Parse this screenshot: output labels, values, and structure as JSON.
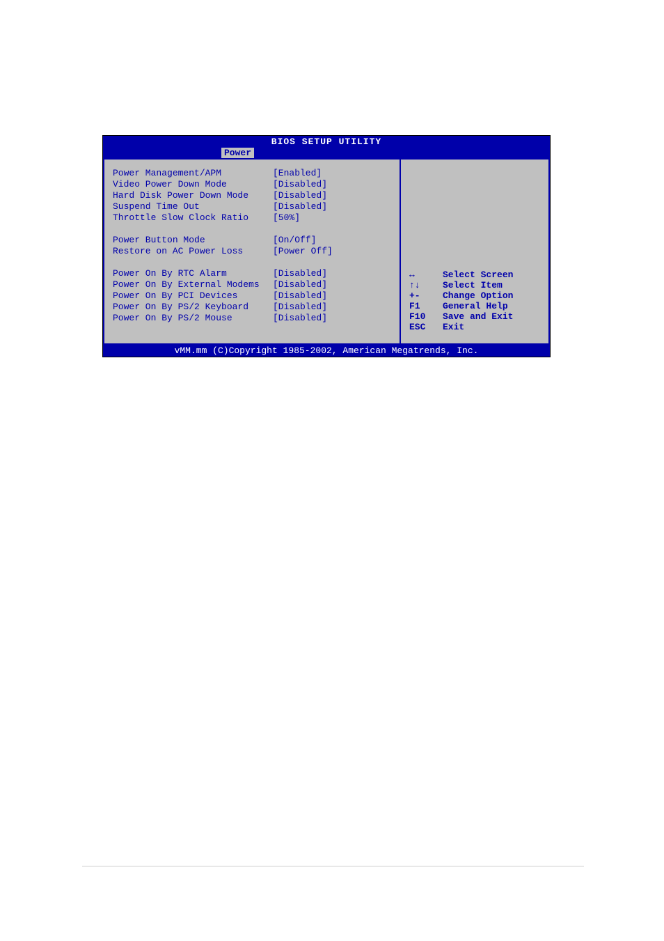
{
  "title": "BIOS SETUP UTILITY",
  "active_tab": "Power",
  "settings_group1": [
    {
      "label": "Power Management/APM",
      "value": "[Enabled]"
    },
    {
      "label": "Video Power Down Mode",
      "value": "[Disabled]"
    },
    {
      "label": "Hard Disk Power Down Mode",
      "value": "[Disabled]"
    },
    {
      "label": "Suspend Time Out",
      "value": "[Disabled]"
    },
    {
      "label": "Throttle Slow Clock Ratio",
      "value": "[50%]"
    }
  ],
  "settings_group2": [
    {
      "label": "Power Button Mode",
      "value": "[On/Off]"
    },
    {
      "label": "Restore on AC Power Loss",
      "value": "[Power Off]"
    }
  ],
  "settings_group3": [
    {
      "label": "Power On By RTC Alarm",
      "value": "[Disabled]"
    },
    {
      "label": "Power On By External Modems",
      "value": "[Disabled]"
    },
    {
      "label": "Power On By PCI Devices",
      "value": "[Disabled]"
    },
    {
      "label": "Power On By PS/2 Keyboard",
      "value": "[Disabled]"
    },
    {
      "label": "Power On By PS/2 Mouse",
      "value": "[Disabled]"
    }
  ],
  "help": [
    {
      "key": "↔",
      "desc": "Select Screen"
    },
    {
      "key": "↑↓",
      "desc": "Select Item"
    },
    {
      "key": "+-",
      "desc": "Change Option"
    },
    {
      "key": "F1",
      "desc": "General Help"
    },
    {
      "key": "F10",
      "desc": "Save and Exit"
    },
    {
      "key": "ESC",
      "desc": "Exit"
    }
  ],
  "footer": "vMM.mm (C)Copyright 1985-2002, American Megatrends, Inc."
}
